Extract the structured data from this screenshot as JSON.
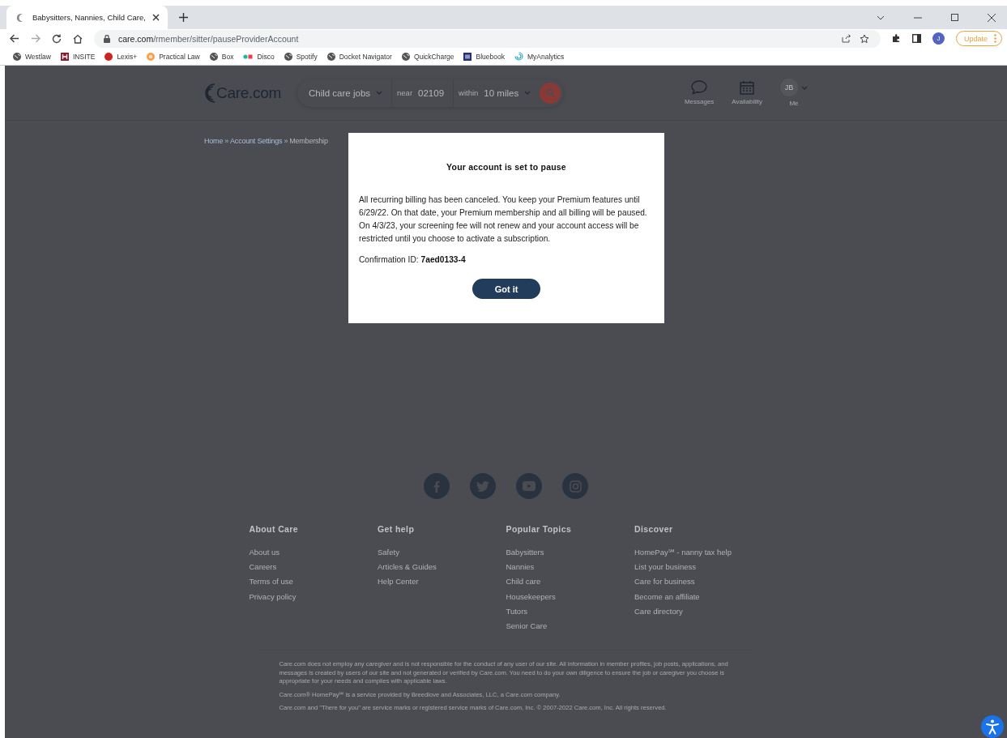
{
  "browser": {
    "tab": {
      "title": "Babysitters, Nannies, Child Care, "
    },
    "address": {
      "domain": "care.com",
      "path": "/rmember/sitter/pauseProviderAccount"
    },
    "bookmarks": [
      {
        "label": "Westlaw",
        "kind": "globe"
      },
      {
        "label": "INSITE",
        "kind": "insite"
      },
      {
        "label": "Lexis+",
        "kind": "lexis"
      },
      {
        "label": "Practical Law",
        "kind": "practical"
      },
      {
        "label": "Box",
        "kind": "globe"
      },
      {
        "label": "Disco",
        "kind": "disco"
      },
      {
        "label": "Spotify",
        "kind": "globe"
      },
      {
        "label": "Docket Navigator",
        "kind": "globe"
      },
      {
        "label": "QuickCharge",
        "kind": "globe"
      },
      {
        "label": "Bluebook",
        "kind": "bluebook"
      },
      {
        "label": "MyAnalytics",
        "kind": "analytics"
      }
    ],
    "profile_initial": "J",
    "update_button": "Update"
  },
  "header": {
    "logo": "Care.com",
    "search": {
      "category": "Child care jobs",
      "near_label": "near",
      "zip": "02109",
      "within_label": "within",
      "distance": "10 miles"
    },
    "nav": [
      {
        "label": "Messages",
        "kind": "messages"
      },
      {
        "label": "Availability",
        "kind": "calendar"
      }
    ],
    "user": {
      "initials": "JB",
      "label": "Me"
    }
  },
  "breadcrumb": [
    {
      "label": "Home",
      "kind": "link"
    },
    {
      "label": "»",
      "kind": "separator"
    },
    {
      "label": "Account Settings",
      "kind": "link"
    },
    {
      "label": "»",
      "kind": "separator"
    },
    {
      "label": "Membership",
      "kind": "current"
    }
  ],
  "modal": {
    "title": "Your account is set to pause",
    "body": "All recurring billing has been canceled. You keep your Premium features until 6/29/22. On that date, your Premium membership and all billing will be paused. On 4/3/23, your screening fee will not renew and your account access will be restricted until you choose to activate a subscription.",
    "confirmation_label": "Confirmation ID:",
    "confirmation_id": "7aed0133-4",
    "button": "Got it"
  },
  "footer": {
    "social": [
      {
        "kind": "facebook"
      },
      {
        "kind": "twitter"
      },
      {
        "kind": "youtube"
      },
      {
        "kind": "instagram"
      }
    ],
    "columns": [
      {
        "heading": "About Care",
        "links": [
          "About us",
          "Careers",
          "Terms of use",
          "Privacy policy"
        ]
      },
      {
        "heading": "Get help",
        "links": [
          "Safety",
          "Articles & Guides",
          "Help Center"
        ]
      },
      {
        "heading": "Popular Topics",
        "links": [
          "Babysitters",
          "Nannies",
          "Child care",
          "Housekeepers",
          "Tutors",
          "Senior Care"
        ]
      },
      {
        "heading": "Discover",
        "links": [
          "HomePay℠ - nanny tax help",
          "List your business",
          "Care for business",
          "Become an affiliate",
          "Care directory"
        ]
      }
    ],
    "legal": [
      "Care.com does not employ any caregiver and is not responsible for the conduct of any user of our site. All information in member profiles, job posts, applications, and messages is created by users of our site and not generated or verified by Care.com. You need to do your own diligence to ensure the job or caregiver you choose is appropriate for your needs and complies with applicable laws.",
      "Care.com® HomePay℠ is a service provided by Breedlove and Associates, LLC, a Care.com company.",
      "Care.com and \"There for you\" are service marks or registered service marks of Care.com, Inc. © 2007-2022 Care.com, Inc. All rights reserved."
    ]
  }
}
